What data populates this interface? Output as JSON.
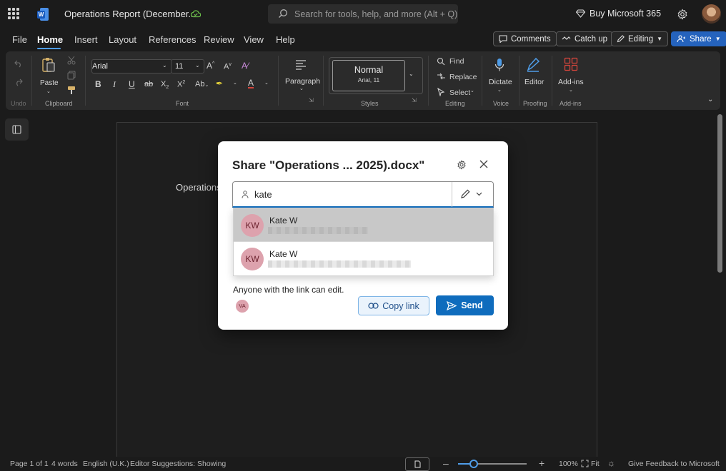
{
  "title_bar": {
    "doc_title": "Operations Report (December...",
    "search_placeholder": "Search for tools, help, and more (Alt + Q)",
    "buy_label": "Buy Microsoft 365"
  },
  "menu": {
    "items": [
      "File",
      "Home",
      "Insert",
      "Layout",
      "References",
      "Review",
      "View",
      "Help"
    ],
    "active": "Home",
    "comments_label": "Comments",
    "catchup_label": "Catch up",
    "editing_label": "Editing",
    "share_label": "Share"
  },
  "ribbon": {
    "undo_label": "Undo",
    "paste_label": "Paste",
    "clipboard_label": "Clipboard",
    "font_name": "Arial",
    "font_size": "11",
    "font_label": "Font",
    "paragraph_label": "Paragraph",
    "style_name": "Normal",
    "style_sub": "Arial, 11",
    "styles_label": "Styles",
    "find_label": "Find",
    "replace_label": "Replace",
    "select_label": "Select",
    "editing_group_label": "Editing",
    "dictate_label": "Dictate",
    "voice_label": "Voice",
    "editor_label": "Editor",
    "proofing_label": "Proofing",
    "addins_label": "Add-ins",
    "addins_group_label": "Add-ins"
  },
  "document": {
    "visible_text": "Operations"
  },
  "share_dialog": {
    "title": "Share \"Operations ... 2025).docx\"",
    "input_value": "kate",
    "suggestions": [
      {
        "initials": "KW",
        "name": "Kate W"
      },
      {
        "initials": "KW",
        "name": "Kate W"
      }
    ],
    "link_info": "Anyone with the link can edit.",
    "owner_initials": "VA",
    "copy_link_label": "Copy link",
    "send_label": "Send"
  },
  "status_bar": {
    "page": "Page 1 of 1",
    "words": "4 words",
    "language": "English (U.K.)",
    "editor_suggestions": "Editor Suggestions: Showing",
    "zoom": "100%",
    "fit": "Fit",
    "feedback": "Give Feedback to Microsoft"
  }
}
